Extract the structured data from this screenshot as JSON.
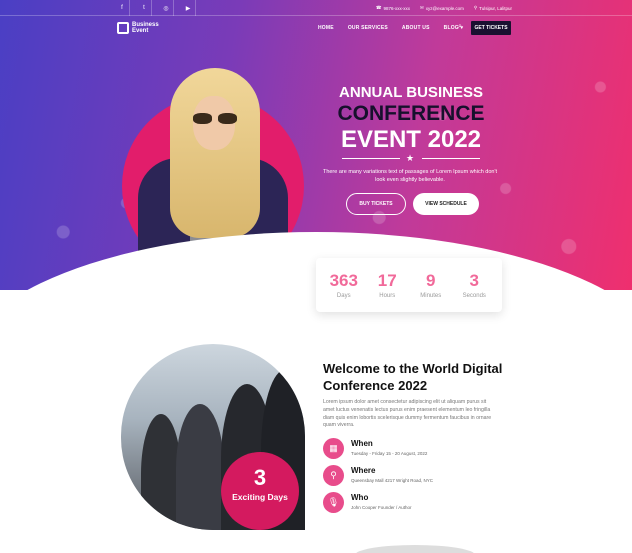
{
  "topbar": {
    "social": [
      "f",
      "t",
      "◎",
      "▶"
    ],
    "contact": [
      {
        "icon": "phone-icon",
        "text": "9876-xxx-xxx"
      },
      {
        "icon": "mail-icon",
        "text": "xyz@example.com"
      },
      {
        "icon": "map-pin-icon",
        "text": "Tulsipur, Lalitpur"
      }
    ]
  },
  "brand": {
    "name": "Business Event"
  },
  "nav": {
    "items": [
      "HOME",
      "OUR SERVICES",
      "ABOUT US",
      "BLOG ▾"
    ],
    "cta": "GET TICKETS"
  },
  "hero": {
    "line1": "ANNUAL BUSINESS",
    "line2": "CONFERENCE",
    "line3": "EVENT 2022",
    "desc": "There are many variations text of passages of Lorem Ipsum which don't look even slightly believable.",
    "btn_primary": "BUY TICKETS",
    "btn_secondary": "VIEW SCHEDULE"
  },
  "countdown": [
    {
      "value": "363",
      "label": "Days"
    },
    {
      "value": "17",
      "label": "Hours"
    },
    {
      "value": "9",
      "label": "Minutes"
    },
    {
      "value": "3",
      "label": "Seconds"
    }
  ],
  "about": {
    "badge_number": "3",
    "badge_text": "Exciting Days",
    "title": "Welcome to the World Digital Conference 2022",
    "body": "Lorem ipsum dolor amet consectetur adipiscing elit ut aliquam purus sit amet luctus venenatis lectus purus enim praesent elementum leo fringilla diam quis enim lobortis scelerisque dummy fermentum faucibus in ornare quam viverra.",
    "info": [
      {
        "icon": "calendar-icon",
        "title": "When",
        "detail": "Tuesday - Friday 15 - 20 August, 2022"
      },
      {
        "icon": "map-pin-icon",
        "title": "Where",
        "detail": "Queensbay Mall 4217 Wright Road, NYC"
      },
      {
        "icon": "microphone-icon",
        "title": "Who",
        "detail": "John Cooper Founder / Author"
      }
    ]
  },
  "colors": {
    "accent": "#e21d6b",
    "dark": "#16102c",
    "count": "#f16a9a"
  }
}
